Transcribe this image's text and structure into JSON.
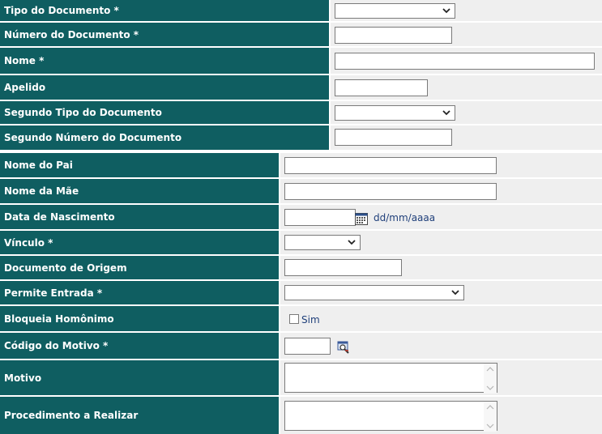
{
  "fields": {
    "tipo_documento": {
      "label": "Tipo do Documento *",
      "value": ""
    },
    "numero_documento": {
      "label": "Número do Documento *",
      "value": ""
    },
    "nome": {
      "label": "Nome *",
      "value": ""
    },
    "apelido": {
      "label": "Apelido",
      "value": ""
    },
    "segundo_tipo_documento": {
      "label": "Segundo Tipo do Documento",
      "value": ""
    },
    "segundo_numero_documento": {
      "label": "Segundo Número do Documento",
      "value": ""
    },
    "nome_pai": {
      "label": "Nome do Pai",
      "value": ""
    },
    "nome_mae": {
      "label": "Nome da Mãe",
      "value": ""
    },
    "data_nascimento": {
      "label": "Data de Nascimento",
      "value": "",
      "format_hint": "dd/mm/aaaa"
    },
    "vinculo": {
      "label": "Vínculo *",
      "value": ""
    },
    "documento_origem": {
      "label": "Documento de Origem",
      "value": ""
    },
    "permite_entrada": {
      "label": "Permite Entrada *",
      "value": ""
    },
    "bloqueia_homonimo": {
      "label": "Bloqueia Homônimo",
      "checkbox_label": "Sim",
      "checked": false
    },
    "codigo_motivo": {
      "label": "Código do Motivo *",
      "value": ""
    },
    "motivo": {
      "label": "Motivo",
      "value": ""
    },
    "procedimento": {
      "label": "Procedimento a Realizar",
      "value": ""
    }
  },
  "colors": {
    "label_bg": "#0f5e61",
    "value_bg": "#efefef",
    "hint_text": "#1f3f7a"
  },
  "icons": {
    "calendar": "calendar-icon",
    "lookup": "search-lookup-icon"
  }
}
